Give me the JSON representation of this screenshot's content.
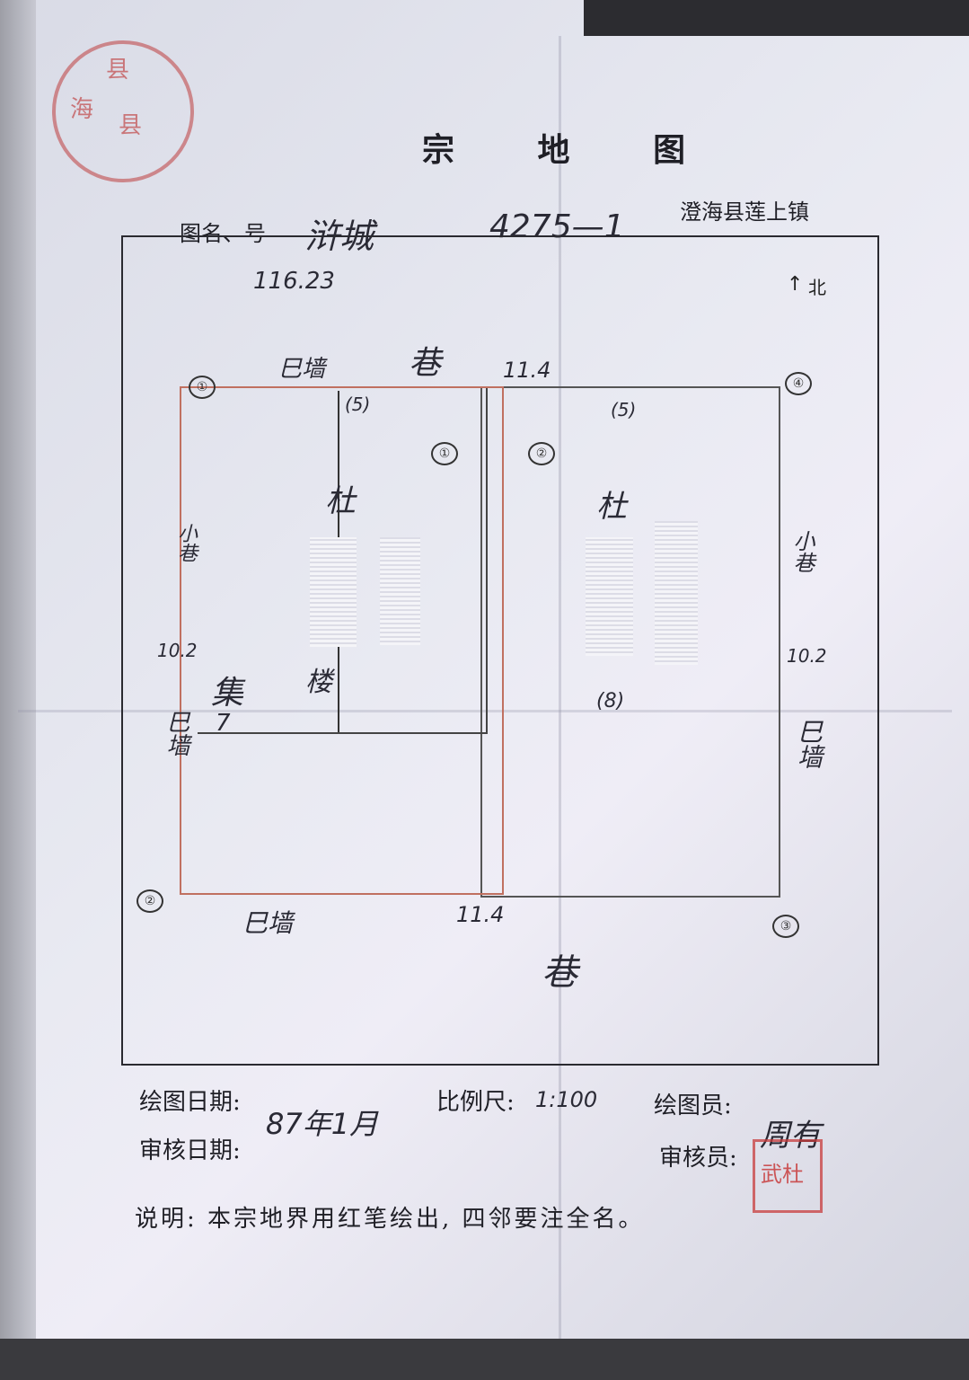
{
  "title": "宗  地  图",
  "map_name_label": "图名、号",
  "map_name_value": "浒城",
  "map_number_value": "4275—1",
  "county_town": "澄海县莲上镇",
  "north": "北",
  "dimensions": {
    "top_total": "116.23",
    "top_side": "11.4",
    "bottom_side": "11.4",
    "left_side": "10.2",
    "right_side": "10.2",
    "left_inner_dim": "(5)",
    "right_inner_dim": "(5)",
    "right_lower_dim": "(8)"
  },
  "neighbors": {
    "top_wall": "巳墙",
    "top_lane": "巷",
    "left_lane": "小巷",
    "left_wall": "巳墙",
    "right_lane": "小巷",
    "right_wall": "巳墙",
    "bottom_wall": "巳墙",
    "bottom_lane": "巷",
    "left_owner_surname": "杜",
    "right_owner_surname": "杜",
    "left_extra": "集",
    "left_extra2": "7",
    "left_extra3": "楼"
  },
  "corners": [
    "①",
    "②",
    "③",
    "④"
  ],
  "lot_numbers": [
    "①",
    "②"
  ],
  "footer": {
    "draw_date_label": "绘图日期:",
    "draw_date_value": "87年1月",
    "review_date_label": "审核日期:",
    "scale_label": "比例尺:",
    "scale_value": "1:100",
    "drafter_label": "绘图员:",
    "reviewer_label": "审核员:",
    "reviewer_value": "周有",
    "note": "说明: 本宗地界用红笔绘出, 四邻要注全名。"
  },
  "seals": {
    "county_seal_text": [
      "县",
      "海",
      "县"
    ],
    "reviewer_seal_text": "武杜"
  }
}
